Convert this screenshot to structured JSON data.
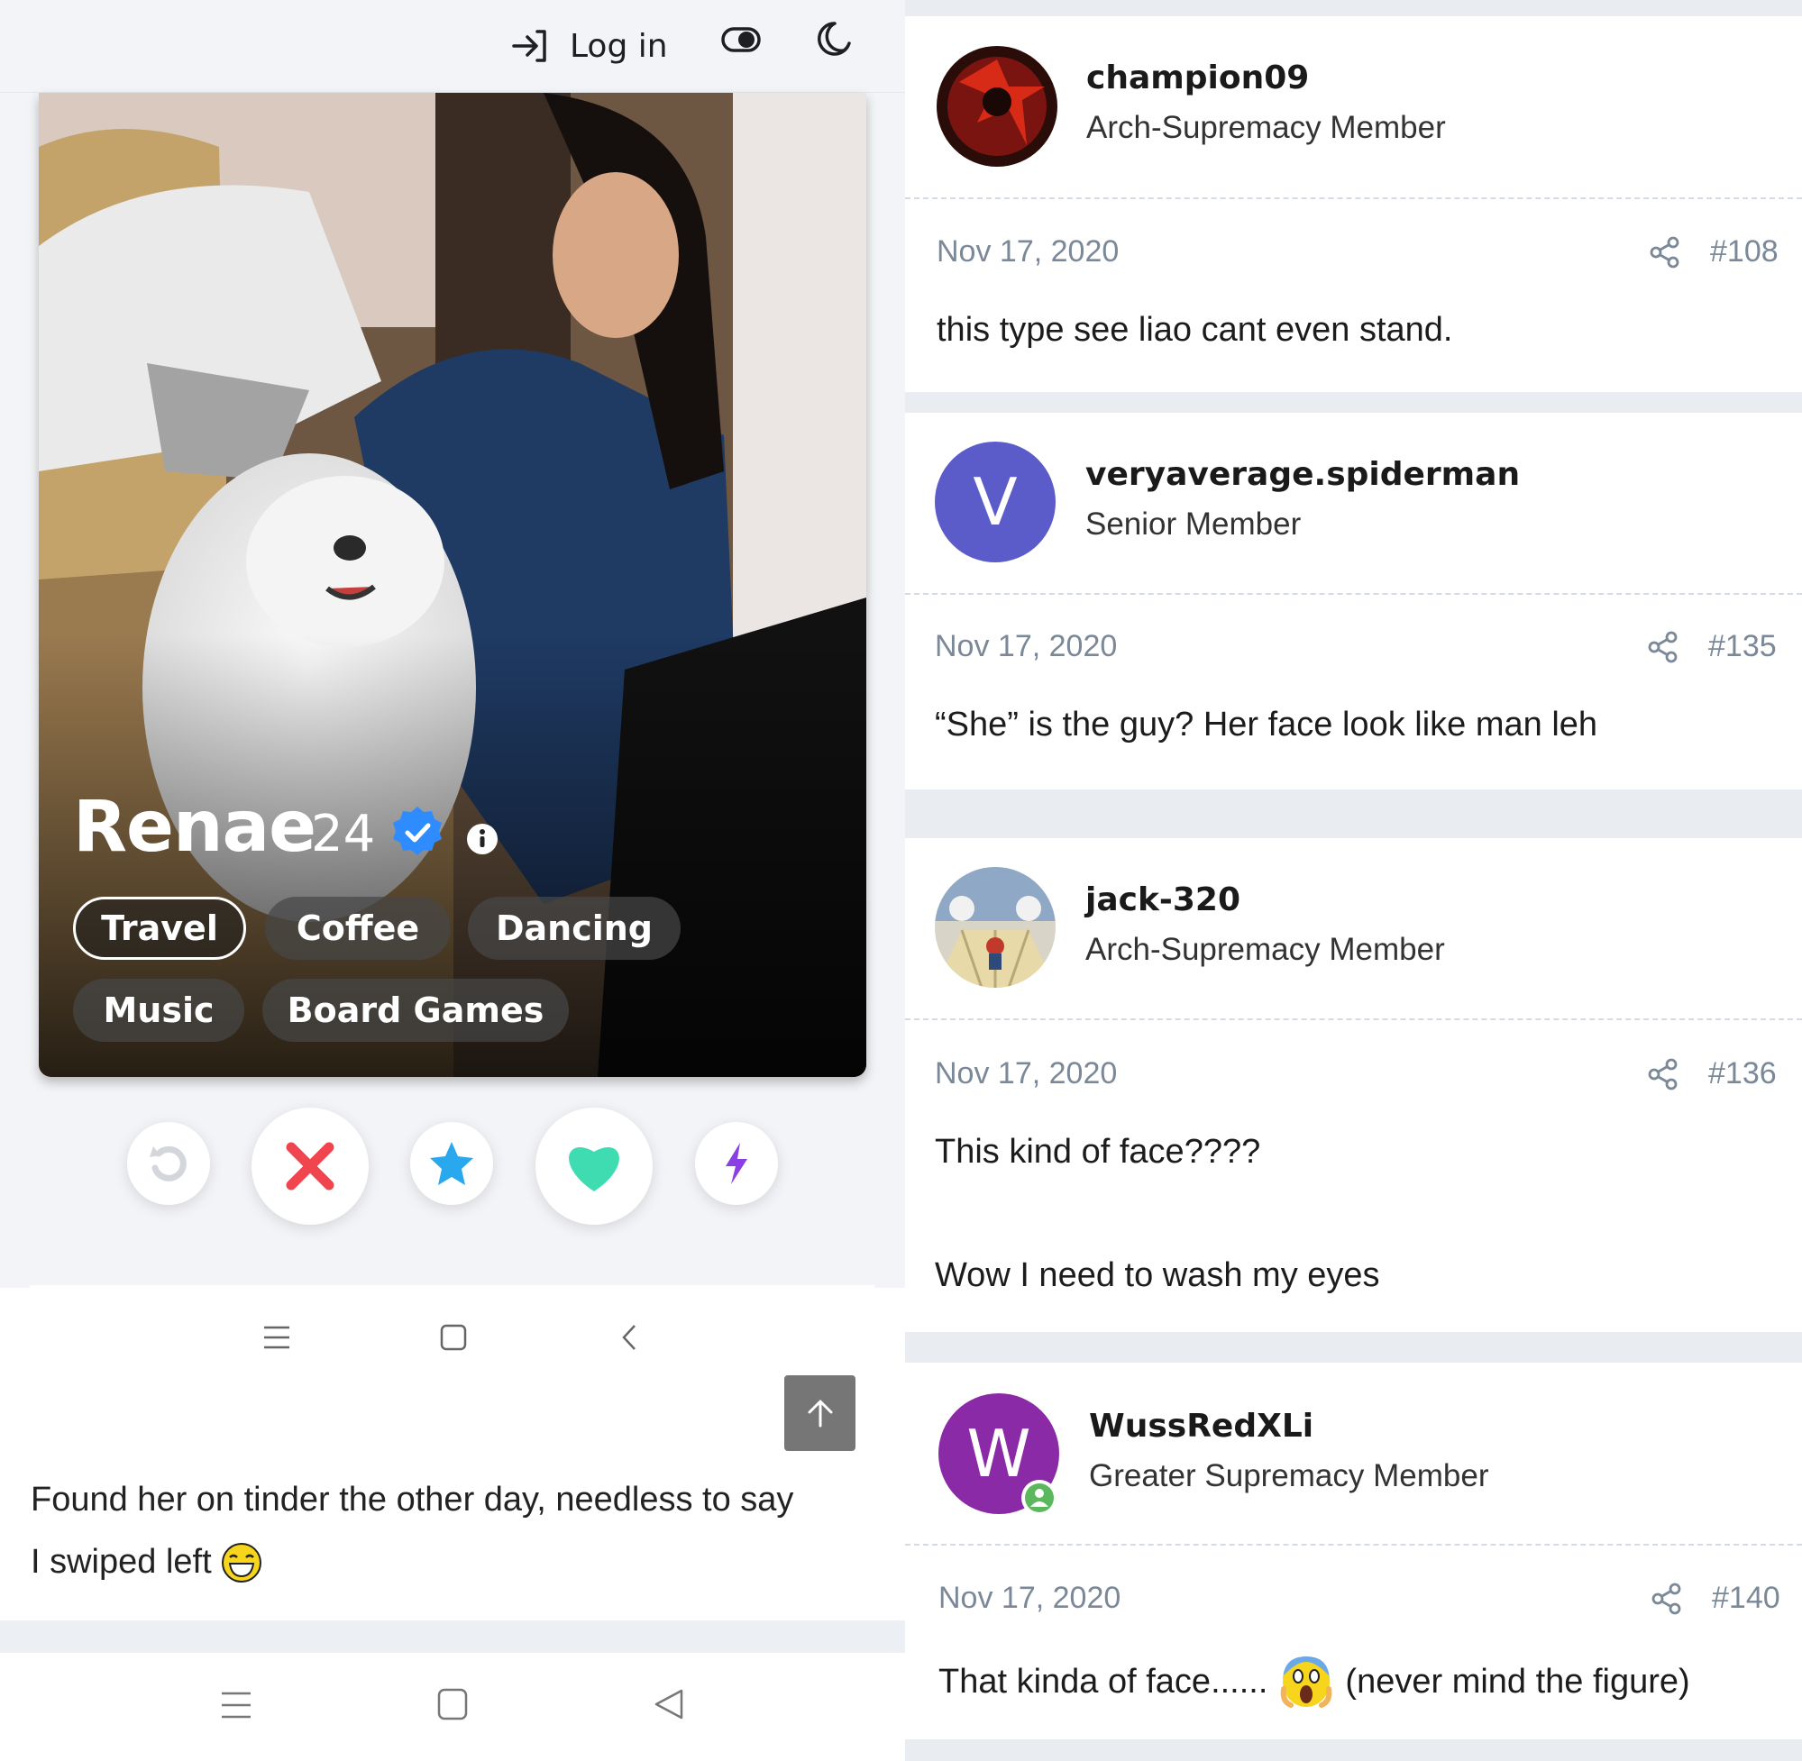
{
  "topbar": {
    "login_label": "Log in"
  },
  "profile": {
    "name": "Renae",
    "age": "24",
    "interests": [
      "Travel",
      "Coffee",
      "Dancing",
      "Music",
      "Board Games"
    ],
    "selected_interest": "Travel"
  },
  "actions": [
    "rewind-icon",
    "nope-icon",
    "super-like-icon",
    "like-icon",
    "boost-icon"
  ],
  "caption": {
    "line1": "Found her on tinder the other day, needless to say",
    "line2": "I swiped left"
  },
  "posts": [
    {
      "username": "champion09",
      "title": "Arch-Supremacy Member",
      "date": "Nov 17, 2020",
      "number": "#108",
      "lines": [
        "this type see liao cant even stand."
      ]
    },
    {
      "username": "veryaverage.spiderman",
      "title": "Senior Member",
      "date": "Nov 17, 2020",
      "number": "#135",
      "avatar_letter": "V",
      "avatar_color": "#5b5bc9",
      "lines": [
        "“She” is the guy? Her face look like man leh"
      ]
    },
    {
      "username": "jack-320",
      "title": "Arch-Supremacy Member",
      "date": "Nov 17, 2020",
      "number": "#136",
      "lines": [
        "This kind of face????",
        "Wow I need to wash my eyes"
      ]
    },
    {
      "username": "WussRedXLi",
      "title": "Greater Supremacy Member",
      "date": "Nov 17, 2020",
      "number": "#140",
      "avatar_letter": "W",
      "avatar_color": "#8a2aa6",
      "lines": [
        "That kinda of face......",
        "(never mind the figure)"
      ]
    }
  ],
  "colors": {
    "nope": "#f0454f",
    "super_like": "#2aa8ee",
    "like": "#3fdcb2",
    "boost": "#8b3fe3",
    "verified": "#2f8cff"
  }
}
